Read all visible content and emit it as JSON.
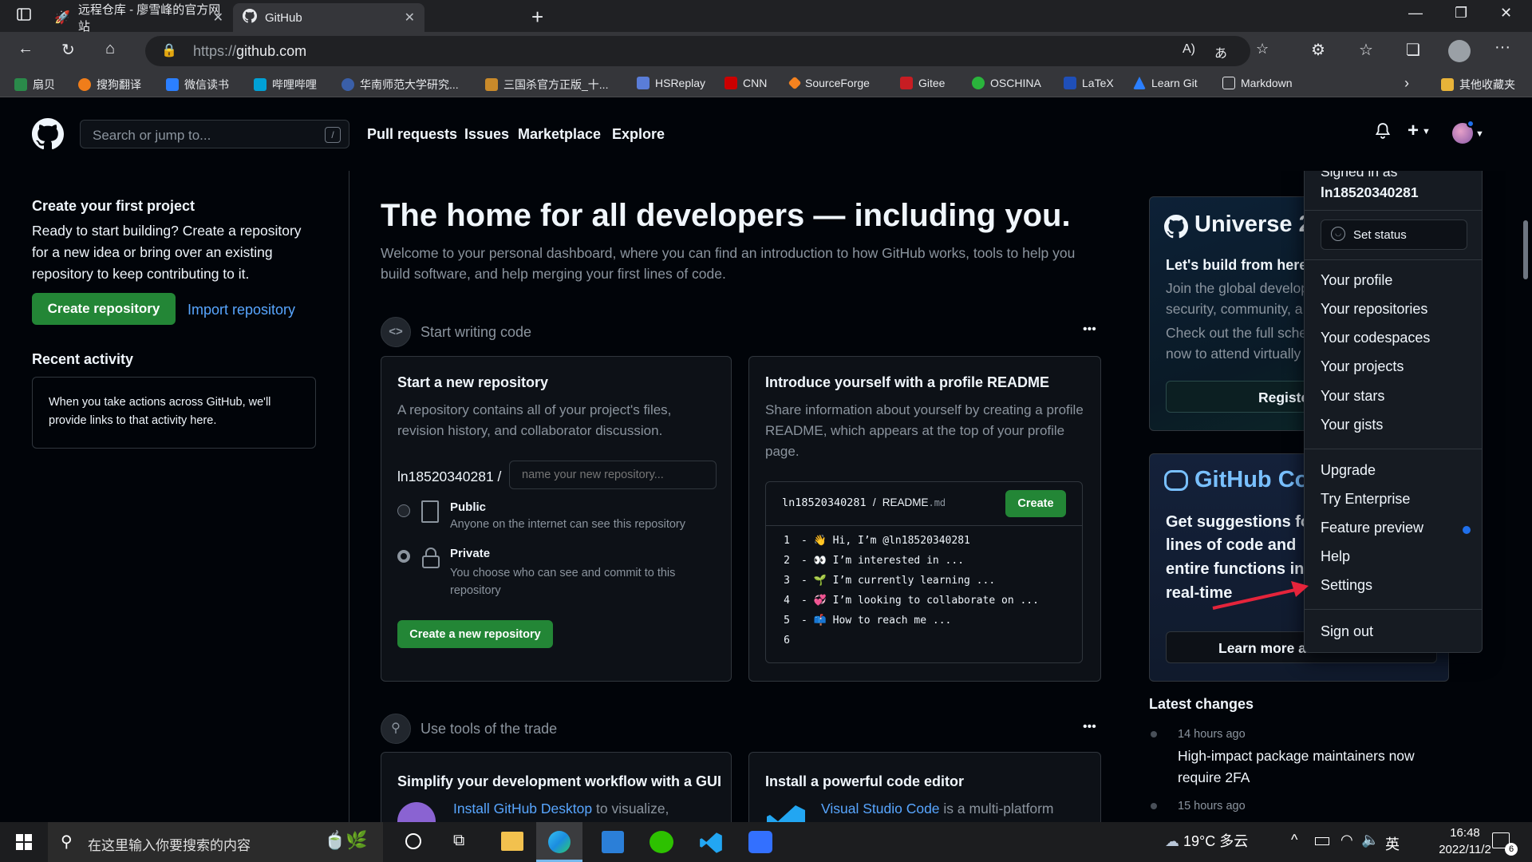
{
  "browser": {
    "tabs": [
      {
        "title": "远程仓库 - 廖雪峰的官方网站",
        "active": false
      },
      {
        "title": "GitHub",
        "active": true
      }
    ],
    "url_prefix": "https://",
    "url_host": "github.com",
    "bookmarks": [
      "扇贝",
      "搜狗翻译",
      "微信读书",
      "哔哩哔哩",
      "华南师范大学研究...",
      "三国杀官方正版_十...",
      "HSReplay",
      "CNN",
      "SourceForge",
      "Gitee",
      "OSCHINA",
      "LaTeX",
      "Learn Git",
      "Markdown",
      "其他收藏夹"
    ]
  },
  "header": {
    "search_placeholder": "Search or jump to...",
    "search_shortcut": "/",
    "nav": [
      "Pull requests",
      "Issues",
      "Marketplace",
      "Explore"
    ],
    "plus": "+"
  },
  "sidebar": {
    "create_title": "Create your first project",
    "create_desc": "Ready to start building? Create a repository for a new idea or bring over an existing repository to keep contributing to it.",
    "create_btn": "Create repository",
    "import_link": "Import repository",
    "recent_title": "Recent activity",
    "recent_desc": "When you take actions across GitHub, we'll provide links to that activity here."
  },
  "hero": {
    "title": "The home for all developers — including you.",
    "subtitle": "Welcome to your personal dashboard, where you can find an introduction to how GitHub works, tools to help you build software, and help merging your first lines of code."
  },
  "section1": {
    "title": "Start writing code",
    "more": "•••",
    "new_repo": {
      "title": "Start a new repository",
      "desc": "A repository contains all of your project's files, revision history, and collaborator discussion.",
      "owner": "ln18520340281 /",
      "name_placeholder": "name your new repository...",
      "public_label": "Public",
      "public_desc": "Anyone on the internet can see this repository",
      "private_label": "Private",
      "private_desc": "You choose who can see and commit to this repository",
      "create_btn": "Create a new repository",
      "selected": "Private"
    },
    "readme": {
      "title": "Introduce yourself with a profile README",
      "desc": "Share information about yourself by creating a profile README, which appears at the top of your profile page.",
      "path_user": "ln18520340281",
      "path_sep": "/",
      "path_file": "README",
      "path_ext": ".md",
      "create_btn": "Create",
      "lines": [
        {
          "n": "1",
          "text": "- 👋 Hi, I’m @ln18520340281"
        },
        {
          "n": "2",
          "text": "- 👀 I’m interested in ..."
        },
        {
          "n": "3",
          "text": "- 🌱 I’m currently learning ..."
        },
        {
          "n": "4",
          "text": "- 💞️ I’m looking to collaborate on ..."
        },
        {
          "n": "5",
          "text": "- 📫 How to reach me ..."
        },
        {
          "n": "6",
          "text": ""
        }
      ]
    }
  },
  "section2": {
    "title": "Use tools of the trade",
    "more": "•••",
    "card1_title": "Simplify your development workflow with a GUI",
    "card1_link": "Install GitHub Desktop",
    "card1_rest": "to visualize,",
    "card2_title": "Install a powerful code editor",
    "card2_link": "Visual Studio Code",
    "card2_rest": "is a multi-platform"
  },
  "right": {
    "universe_title": "Universe 2",
    "universe_sub": "Let's build from here",
    "universe_desc1": "Join the global develop",
    "universe_desc2": "security, community, a",
    "universe_desc3": "Check out the full sche",
    "universe_desc4": "now to attend virtually",
    "universe_btn": "Registe",
    "copilot_title": "GitHub Co",
    "copilot_desc1": "Get suggestions fo",
    "copilot_desc2": "lines of code and",
    "copilot_desc3": "entire functions in",
    "copilot_desc4": "real-time",
    "copilot_btn": "Learn more a",
    "latest_title": "Latest changes",
    "changes": [
      {
        "time": "14 hours ago",
        "text": "High-impact package maintainers now require 2FA"
      },
      {
        "time": "15 hours ago",
        "text": ""
      }
    ]
  },
  "dropdown": {
    "signed_in_as": "Signed in as",
    "username": "ln18520340281",
    "set_status": "Set status",
    "group1": [
      "Your profile",
      "Your repositories",
      "Your codespaces",
      "Your projects",
      "Your stars",
      "Your gists"
    ],
    "group2": [
      "Upgrade",
      "Try Enterprise",
      "Feature preview",
      "Help",
      "Settings"
    ],
    "sign_out": "Sign out"
  },
  "taskbar": {
    "search_placeholder": "在这里输入你要搜索的内容",
    "weather": "19°C 多云",
    "ime": "英",
    "time": "16:48",
    "date": "2022/11/2",
    "notif_count": "6"
  },
  "colors": {
    "accent_green": "#238636",
    "link_blue": "#58a6ff",
    "bg": "#0d1117",
    "feature_dot": "#1f6feb",
    "arrow": "#e5243b"
  }
}
